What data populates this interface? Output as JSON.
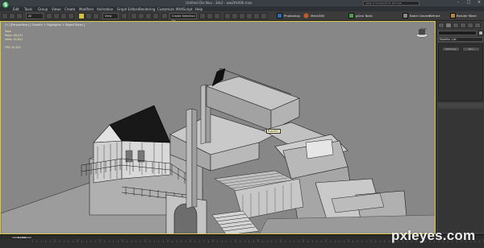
{
  "window": {
    "title": "Untitled Die Neu - 3ds2 - ww2tfs006.max",
    "search_placeholder": "Type a keyword or phrase",
    "logo_letter": "S"
  },
  "menu": [
    "Edit",
    "Tools",
    "Group",
    "Views",
    "Create",
    "Modifiers",
    "Animation",
    "Graph Editors",
    "Rendering",
    "Customize",
    "MAXScript",
    "Help"
  ],
  "toolbar": {
    "filter_select": "All",
    "refcoord_select": "View",
    "selection_set": "Create Selection Se",
    "right_labels": [
      "Photoshop",
      "Mesh360",
      "gGeo Tools",
      "Batch Geoms",
      "Refract",
      "Render Mesh"
    ]
  },
  "viewport": {
    "label": "[+] [Perspective] [ Smooth + Highlights + Edged Faces ]",
    "stats": [
      {
        "label": "Total",
        "value": ""
      },
      {
        "label": "Polys:",
        "value": "48,241"
      },
      {
        "label": "Verts:",
        "value": "43,812"
      },
      {
        "label": "",
        "value": ""
      },
      {
        "label": "FPS:",
        "value": "45,451"
      }
    ],
    "tooltip": "Box002"
  },
  "command_panel": {
    "modifier_list": "Modifier List",
    "stack_buttons": [
      "Edit Poly",
      "Box"
    ]
  },
  "timeline": {
    "slider": "0 / 100"
  },
  "watermark": {
    "brand": "pxleyes.com"
  },
  "colors": {
    "viewport_bg": "#8a8a8a",
    "active_border": "#d9c848",
    "panel_bg": "#3c3c3c"
  },
  "icons": [
    "app-logo-icon",
    "select-icon",
    "move-icon",
    "rotate-icon",
    "scale-icon",
    "snap-icon",
    "render-icon",
    "teapot-icon",
    "viewcube-icon"
  ]
}
